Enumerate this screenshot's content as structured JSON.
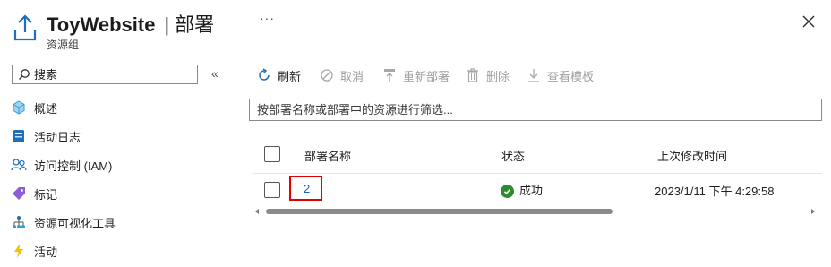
{
  "header": {
    "title": "ToyWebsite",
    "separator": "|",
    "section": "部署",
    "subtitle": "资源组",
    "more": "···",
    "icons": {
      "resource": "upload-arrow-icon",
      "close": "close-icon"
    }
  },
  "sidebar": {
    "search": {
      "placeholder": "搜索",
      "icon": "search-icon"
    },
    "collapse_icon": "double-chevron-left-icon",
    "items": [
      {
        "label": "概述",
        "icon": "overview-cube-icon"
      },
      {
        "label": "活动日志",
        "icon": "activity-log-icon"
      },
      {
        "label": "访问控制 (IAM)",
        "icon": "people-icon"
      },
      {
        "label": "标记",
        "icon": "tag-icon"
      },
      {
        "label": "资源可视化工具",
        "icon": "hierarchy-icon"
      },
      {
        "label": "活动",
        "icon": "lightning-icon"
      }
    ]
  },
  "toolbar": {
    "refresh": "刷新",
    "cancel": "取消",
    "redeploy": "重新部署",
    "delete": "删除",
    "view_template": "查看模板"
  },
  "filter": {
    "placeholder": "按部署名称或部署中的资源进行筛选..."
  },
  "table": {
    "columns": [
      "部署名称",
      "状态",
      "上次修改时间"
    ],
    "rows": [
      {
        "name": "2",
        "status": "成功",
        "modified": "2023/1/11 下午 4:29:58"
      }
    ]
  },
  "colors": {
    "accent": "#0078d4",
    "link": "#1565c0",
    "success": "#2e8b2e",
    "highlight": "#e00000"
  }
}
